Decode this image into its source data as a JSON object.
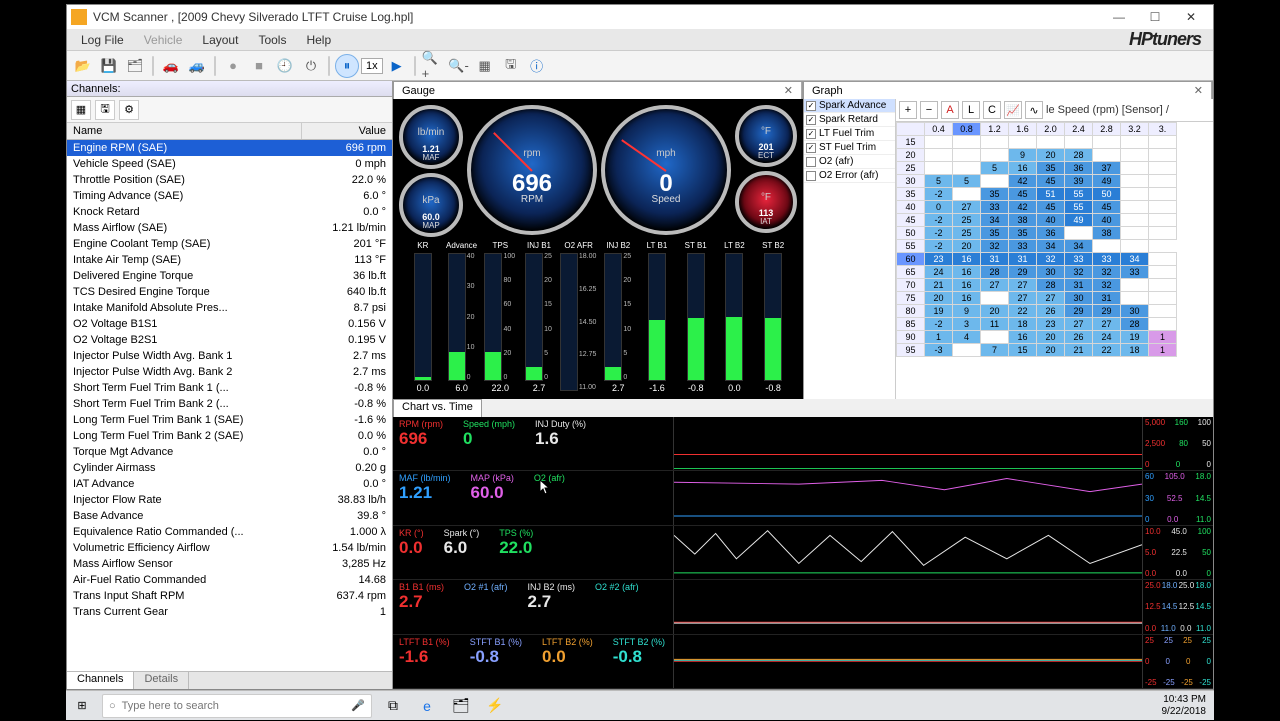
{
  "window": {
    "title": "VCM Scanner ,   [2009 Chevy Silverado LTFT Cruise Log.hpl]"
  },
  "menu": {
    "items": [
      "Log File",
      "Vehicle",
      "Layout",
      "Tools",
      "Help"
    ],
    "disabled_index": 1,
    "brand": "HPtuners"
  },
  "toolbar_speed": "1x",
  "channels": {
    "header": "Channels:",
    "col_name": "Name",
    "col_value": "Value",
    "tabs": [
      "Channels",
      "Details"
    ],
    "rows": [
      {
        "n": "Engine RPM (SAE)",
        "v": "696 rpm",
        "sel": true
      },
      {
        "n": "Vehicle Speed (SAE)",
        "v": "0 mph"
      },
      {
        "n": "Throttle Position (SAE)",
        "v": "22.0 %"
      },
      {
        "n": "Timing Advance (SAE)",
        "v": "6.0 °"
      },
      {
        "n": "Knock Retard",
        "v": "0.0 °"
      },
      {
        "n": "Mass Airflow (SAE)",
        "v": "1.21 lb/min"
      },
      {
        "n": "Engine Coolant Temp (SAE)",
        "v": "201 °F"
      },
      {
        "n": "Intake Air Temp (SAE)",
        "v": "113 °F"
      },
      {
        "n": "Delivered Engine Torque",
        "v": "36 lb.ft"
      },
      {
        "n": "TCS Desired Engine Torque",
        "v": "640 lb.ft"
      },
      {
        "n": "Intake Manifold Absolute Pres...",
        "v": "8.7 psi"
      },
      {
        "n": "O2 Voltage B1S1",
        "v": "0.156 V"
      },
      {
        "n": "O2 Voltage B2S1",
        "v": "0.195 V"
      },
      {
        "n": "Injector Pulse Width Avg. Bank 1",
        "v": "2.7 ms"
      },
      {
        "n": "Injector Pulse Width Avg. Bank 2",
        "v": "2.7 ms"
      },
      {
        "n": "Short Term Fuel Trim Bank 1 (...",
        "v": "-0.8 %"
      },
      {
        "n": "Short Term Fuel Trim Bank 2 (...",
        "v": "-0.8 %"
      },
      {
        "n": "Long Term Fuel Trim Bank 1 (SAE)",
        "v": "-1.6 %"
      },
      {
        "n": "Long Term Fuel Trim Bank 2 (SAE)",
        "v": "0.0 %"
      },
      {
        "n": "Torque Mgt Advance",
        "v": "0.0 °"
      },
      {
        "n": "Cylinder Airmass",
        "v": "0.20 g"
      },
      {
        "n": "IAT Advance",
        "v": "0.0 °"
      },
      {
        "n": "Injector Flow Rate",
        "v": "38.83 lb/h"
      },
      {
        "n": "Base Advance",
        "v": "39.8 °"
      },
      {
        "n": "Equivalence Ratio Commanded (...",
        "v": "1.000 λ"
      },
      {
        "n": "Volumetric Efficiency Airflow",
        "v": "1.54 lb/min"
      },
      {
        "n": "Mass Airflow Sensor",
        "v": "3,285 Hz"
      },
      {
        "n": "Air-Fuel Ratio Commanded",
        "v": "14.68"
      },
      {
        "n": "Trans Input Shaft RPM",
        "v": "637.4 rpm"
      },
      {
        "n": "Trans Current Gear",
        "v": "1"
      }
    ]
  },
  "gauge_tab": "Gauge",
  "gauges": {
    "small_left": [
      {
        "lbl": "MAF",
        "unit": "lb/min",
        "v": "1.21"
      },
      {
        "lbl": "MAP",
        "unit": "kPa",
        "v": "60.0"
      }
    ],
    "big": [
      {
        "lbl": "RPM",
        "unit": "rpm",
        "v": "696",
        "needle": -135
      },
      {
        "lbl": "Speed",
        "unit": "mph",
        "v": "0",
        "needle": -145
      }
    ],
    "small_right": [
      {
        "lbl": "ECT",
        "unit": "°F",
        "v": "201"
      },
      {
        "lbl": "IAT",
        "unit": "°F",
        "v": "113",
        "red": true
      }
    ],
    "bars": [
      {
        "h": "KR",
        "v": "0.0",
        "pct": 2
      },
      {
        "h": "Advance",
        "v": "6.0",
        "pct": 22,
        "scale": [
          "40",
          "30",
          "20",
          "10",
          "0"
        ]
      },
      {
        "h": "TPS",
        "v": "22.0",
        "pct": 22,
        "scale": [
          "100",
          "80",
          "60",
          "40",
          "20",
          "0"
        ]
      },
      {
        "h": "INJ B1",
        "v": "2.7",
        "pct": 10,
        "scale": [
          "25",
          "20",
          "15",
          "10",
          "5",
          "0"
        ]
      },
      {
        "h": "O2 AFR",
        "v": "",
        "pct": 0,
        "scale": [
          "18.00",
          "16.25",
          "14.50",
          "12.75",
          "11.00"
        ]
      },
      {
        "h": "INJ B2",
        "v": "2.7",
        "pct": 10,
        "scale": [
          "25",
          "20",
          "15",
          "10",
          "5",
          "0"
        ]
      },
      {
        "h": "LT B1",
        "v": "-1.6",
        "pct": 48
      },
      {
        "h": "ST B1",
        "v": "-0.8",
        "pct": 49
      },
      {
        "h": "LT B2",
        "v": "0.0",
        "pct": 50
      },
      {
        "h": "ST B2",
        "v": "-0.8",
        "pct": 49
      }
    ]
  },
  "graph_tab": "Graph",
  "checklist": [
    {
      "l": "Spark Advance",
      "c": true,
      "sel": true
    },
    {
      "l": "Spark Retard",
      "c": true
    },
    {
      "l": "LT Fuel Trim",
      "c": true
    },
    {
      "l": "ST Fuel Trim",
      "c": true
    },
    {
      "l": "O2 (afr)",
      "c": false
    },
    {
      "l": "O2 Error (afr)",
      "c": false
    }
  ],
  "table": {
    "axis_label": "le Speed (rpm) [Sensor] /",
    "col_head": [
      "0.4",
      "0.8",
      "1.2",
      "1.6",
      "2.0",
      "2.4",
      "2.8",
      "3.2",
      "3."
    ],
    "col_sel_index": 1,
    "row_head": [
      "15",
      "20",
      "25",
      "30",
      "35",
      "40",
      "45",
      "50",
      "55",
      "60",
      "65",
      "70",
      "75",
      "80",
      "85",
      "90",
      "95"
    ],
    "row_sel_index": 9,
    "rows": [
      [
        "",
        "",
        "",
        "",
        "",
        "",
        "",
        "",
        ""
      ],
      [
        "",
        "",
        "",
        "9",
        "20",
        "28",
        "",
        "",
        ""
      ],
      [
        "",
        "",
        "5",
        "16",
        "35",
        "36",
        "37",
        "",
        ""
      ],
      [
        "5",
        "5",
        "",
        "42",
        "45",
        "39",
        "49",
        "",
        ""
      ],
      [
        "-2",
        "",
        "35",
        "45",
        "51",
        "55",
        "50",
        "",
        ""
      ],
      [
        "0",
        "27",
        "33",
        "42",
        "45",
        "55",
        "45",
        "",
        ""
      ],
      [
        "-2",
        "25",
        "34",
        "38",
        "40",
        "49",
        "40",
        "",
        ""
      ],
      [
        "-2",
        "25",
        "35",
        "35",
        "36",
        "",
        "38",
        "",
        ""
      ],
      [
        "-2",
        "20",
        "32",
        "33",
        "34",
        "34",
        "",
        ""
      ],
      [
        "23",
        "16",
        "31",
        "31",
        "32",
        "33",
        "33",
        "34",
        ""
      ],
      [
        "24",
        "16",
        "28",
        "29",
        "30",
        "32",
        "32",
        "33",
        ""
      ],
      [
        "21",
        "16",
        "27",
        "27",
        "28",
        "31",
        "32",
        "",
        ""
      ],
      [
        "20",
        "16",
        "",
        "27",
        "27",
        "30",
        "31",
        "",
        ""
      ],
      [
        "19",
        "9",
        "20",
        "22",
        "26",
        "29",
        "29",
        "30",
        ""
      ],
      [
        "-2",
        "3",
        "11",
        "18",
        "23",
        "27",
        "27",
        "28",
        ""
      ],
      [
        "1",
        "4",
        "",
        "16",
        "20",
        "26",
        "24",
        "19",
        "1"
      ],
      [
        "-3",
        "",
        "7",
        "15",
        "20",
        "21",
        "22",
        "18",
        "1"
      ]
    ],
    "row_colors": [
      [
        0,
        0,
        0,
        0,
        0,
        0,
        0,
        0,
        0
      ],
      [
        0,
        0,
        0,
        1,
        1,
        1,
        0,
        0,
        0
      ],
      [
        0,
        0,
        1,
        1,
        2,
        2,
        2,
        0,
        0
      ],
      [
        1,
        1,
        0,
        2,
        2,
        2,
        2,
        0,
        0
      ],
      [
        1,
        0,
        2,
        2,
        3,
        3,
        3,
        0,
        0
      ],
      [
        1,
        1,
        2,
        2,
        2,
        3,
        2,
        0,
        0
      ],
      [
        1,
        1,
        2,
        2,
        2,
        3,
        2,
        0,
        0
      ],
      [
        1,
        1,
        2,
        2,
        2,
        0,
        2,
        0,
        0
      ],
      [
        1,
        1,
        2,
        2,
        2,
        2,
        0,
        0,
        0
      ],
      [
        3,
        3,
        3,
        3,
        3,
        3,
        3,
        3,
        0
      ],
      [
        1,
        1,
        2,
        2,
        2,
        2,
        2,
        2,
        0
      ],
      [
        1,
        1,
        1,
        1,
        2,
        2,
        2,
        0,
        0
      ],
      [
        1,
        1,
        0,
        1,
        1,
        2,
        2,
        0,
        0
      ],
      [
        1,
        1,
        1,
        1,
        1,
        2,
        2,
        2,
        0
      ],
      [
        1,
        1,
        1,
        1,
        1,
        1,
        1,
        2,
        0
      ],
      [
        1,
        1,
        0,
        1,
        1,
        1,
        1,
        1,
        4
      ],
      [
        1,
        0,
        1,
        1,
        1,
        1,
        1,
        1,
        4
      ]
    ]
  },
  "cvt_tab": "Chart vs. Time",
  "cvt_bands": [
    {
      "labels": [
        {
          "n": "RPM (rpm)",
          "v": "696",
          "c": "#f03030"
        },
        {
          "n": "Speed (mph)",
          "v": "0",
          "c": "#20e060"
        },
        {
          "n": "INJ Duty (%)",
          "v": "1.6",
          "c": "#e8e8e8"
        }
      ],
      "yscale": [
        [
          "5,000",
          "160",
          "100"
        ],
        [
          "2,500",
          "80",
          "50"
        ],
        [
          "0",
          "0",
          "0"
        ]
      ]
    },
    {
      "labels": [
        {
          "n": "MAF (lb/min)",
          "v": "1.21",
          "c": "#30a0ff"
        },
        {
          "n": "MAP (kPa)",
          "v": "60.0",
          "c": "#e060e8"
        },
        {
          "n": "O2 (afr)",
          "v": "",
          "c": "#20e060"
        }
      ],
      "yscale": [
        [
          "60",
          "105.0",
          "18.0"
        ],
        [
          "30",
          "52.5",
          "14.5"
        ],
        [
          "0",
          "0.0",
          "11.0"
        ]
      ]
    },
    {
      "labels": [
        {
          "n": "KR (°)",
          "v": "0.0",
          "c": "#f03030"
        },
        {
          "n": "Spark (°)",
          "v": "6.0",
          "c": "#e8e8e8"
        },
        {
          "n": "TPS (%)",
          "v": "22.0",
          "c": "#20e060"
        }
      ],
      "yscale": [
        [
          "10.0",
          "45.0",
          "100"
        ],
        [
          "5.0",
          "22.5",
          "50"
        ],
        [
          "0.0",
          "0.0",
          "0"
        ]
      ]
    },
    {
      "labels": [
        {
          "n": "B1 B1 (ms)",
          "v": "2.7",
          "c": "#f03030"
        },
        {
          "n": "O2 #1 (afr)",
          "v": "",
          "c": "#70b0ff"
        },
        {
          "n": "INJ B2 (ms)",
          "v": "2.7",
          "c": "#e8e8e8"
        },
        {
          "n": "O2 #2 (afr)",
          "v": "",
          "c": "#30e0d0"
        }
      ],
      "yscale": [
        [
          "25.0",
          "18.0",
          "25.0",
          "18.0"
        ],
        [
          "12.5",
          "14.5",
          "12.5",
          "14.5"
        ],
        [
          "0.0",
          "11.0",
          "0.0",
          "11.0"
        ]
      ]
    },
    {
      "labels": [
        {
          "n": "LTFT B1 (%)",
          "v": "-1.6",
          "c": "#f03030"
        },
        {
          "n": "STFT B1 (%)",
          "v": "-0.8",
          "c": "#88a0ff"
        },
        {
          "n": "LTFT B2 (%)",
          "v": "0.0",
          "c": "#f0a030"
        },
        {
          "n": "STFT B2 (%)",
          "v": "-0.8",
          "c": "#30e0d0"
        }
      ],
      "yscale": [
        [
          "25",
          "25",
          "25",
          "25"
        ],
        [
          "0",
          "0",
          "0",
          "0"
        ],
        [
          "-25",
          "-25",
          "-25",
          "-25"
        ]
      ]
    }
  ],
  "taskbar": {
    "search_placeholder": "Type here to search",
    "time": "10:43 PM",
    "date": "9/22/2018"
  },
  "chart_data": {
    "type": "table",
    "title": "Spark Advance vs Manifold Absolute Pressure (kPa) × le Speed (rpm) [Sensor]",
    "x_categories": [
      0.4,
      0.8,
      1.2,
      1.6,
      2.0,
      2.4,
      2.8,
      3.2
    ],
    "y_categories": [
      15,
      20,
      25,
      30,
      35,
      40,
      45,
      50,
      55,
      60,
      65,
      70,
      75,
      80,
      85,
      90,
      95
    ],
    "values": "see table.rows"
  }
}
